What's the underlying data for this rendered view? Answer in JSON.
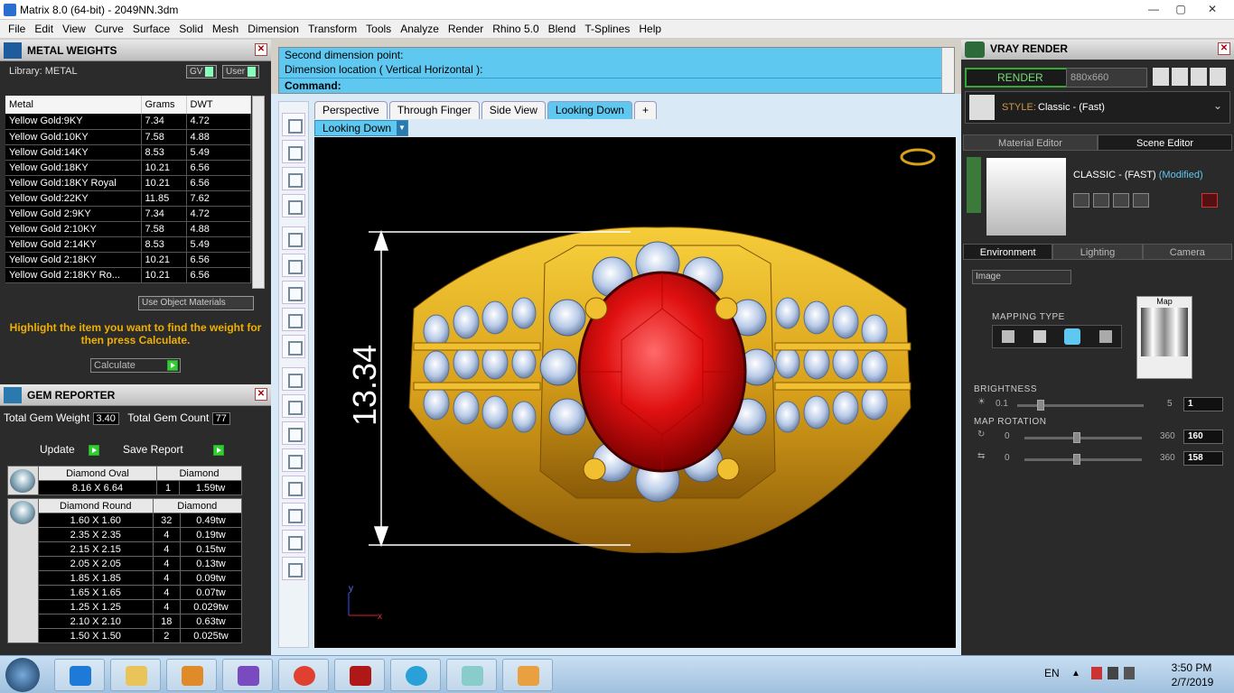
{
  "window": {
    "title": "Matrix 8.0 (64-bit) - 2049NN.3dm",
    "min": "—",
    "max": "▢",
    "close": "✕"
  },
  "menu": [
    "File",
    "Edit",
    "View",
    "Curve",
    "Surface",
    "Solid",
    "Mesh",
    "Dimension",
    "Transform",
    "Tools",
    "Analyze",
    "Render",
    "Rhino 5.0",
    "Blend",
    "T-Splines",
    "Help"
  ],
  "metal_weights": {
    "title": "METAL WEIGHTS",
    "library": "Library: METAL",
    "gv_btn": "GV",
    "user_btn": "User",
    "columns": [
      "Metal",
      "Grams",
      "DWT"
    ],
    "rows": [
      [
        "Yellow Gold:9KY",
        "7.34",
        "4.72"
      ],
      [
        "Yellow Gold:10KY",
        "7.58",
        "4.88"
      ],
      [
        "Yellow Gold:14KY",
        "8.53",
        "5.49"
      ],
      [
        "Yellow Gold:18KY",
        "10.21",
        "6.56"
      ],
      [
        "Yellow Gold:18KY Royal",
        "10.21",
        "6.56"
      ],
      [
        "Yellow Gold:22KY",
        "11.85",
        "7.62"
      ],
      [
        "Yellow Gold 2:9KY",
        "7.34",
        "4.72"
      ],
      [
        "Yellow Gold 2:10KY",
        "7.58",
        "4.88"
      ],
      [
        "Yellow Gold 2:14KY",
        "8.53",
        "5.49"
      ],
      [
        "Yellow Gold 2:18KY",
        "10.21",
        "6.56"
      ],
      [
        "Yellow Gold 2:18KY Ro...",
        "10.21",
        "6.56"
      ]
    ],
    "use_object_materials": "Use Object Materials",
    "hint": "Highlight the item you want to find the weight for then press Calculate.",
    "calculate": "Calculate"
  },
  "gem_reporter": {
    "title": "GEM REPORTER",
    "total_weight_label": "Total Gem Weight",
    "total_weight": "3.40",
    "total_count_label": "Total Gem Count",
    "total_count": "77",
    "update": "Update",
    "save_report": "Save Report",
    "groups": [
      {
        "shape": "Diamond Oval",
        "material": "Diamond",
        "rows": [
          [
            "8.16 X 6.64",
            "1",
            "1.59tw"
          ]
        ]
      },
      {
        "shape": "Diamond Round",
        "material": "Diamond",
        "rows": [
          [
            "1.60 X 1.60",
            "32",
            "0.49tw"
          ],
          [
            "2.35 X 2.35",
            "4",
            "0.19tw"
          ],
          [
            "2.15 X 2.15",
            "4",
            "0.15tw"
          ],
          [
            "2.05 X 2.05",
            "4",
            "0.13tw"
          ],
          [
            "1.85 X 1.85",
            "4",
            "0.09tw"
          ],
          [
            "1.65 X 1.65",
            "4",
            "0.07tw"
          ],
          [
            "1.25 X 1.25",
            "4",
            "0.029tw"
          ],
          [
            "2.10 X 2.10",
            "18",
            "0.63tw"
          ],
          [
            "1.50 X 1.50",
            "2",
            "0.025tw"
          ]
        ]
      }
    ]
  },
  "command": {
    "line1": "Second dimension point:",
    "line2": "Dimension location ( Vertical  Horizontal ):",
    "prompt": "Command:"
  },
  "viewport": {
    "tabs": [
      "Perspective",
      "Through Finger",
      "Side View",
      "Looking Down"
    ],
    "active_tab": "Looking Down",
    "add_tab": "+",
    "selector": "Looking Down",
    "dimension": "13.34",
    "axis_y": "y",
    "axis_x": "x"
  },
  "vray": {
    "title": "VRAY RENDER",
    "render_btn": "RENDER",
    "resolution": "880x660",
    "style_label": "STYLE:",
    "style_value": "Classic - (Fast)",
    "tabs": [
      "Material Editor",
      "Scene Editor"
    ],
    "scene_name": "CLASSIC - (FAST)",
    "modified": "(Modified)",
    "env_tabs": [
      "Environment",
      "Lighting",
      "Camera"
    ],
    "env_select": "Image",
    "map_label": "Map",
    "mapping_type": "MAPPING TYPE",
    "brightness_label": "BRIGHTNESS",
    "brightness": {
      "min": "0.1",
      "max": "5",
      "value": "1"
    },
    "map_rotation_label": "MAP ROTATION",
    "rotation1": {
      "min": "0",
      "max": "360",
      "value": "160"
    },
    "rotation2": {
      "min": "0",
      "max": "360",
      "value": "158"
    }
  },
  "taskbar": {
    "lang": "EN",
    "time": "3:50 PM",
    "date": "2/7/2019"
  },
  "colors": {
    "accent": "#5ec8f0",
    "gold": "#d9a11a",
    "ruby": "#d41010",
    "hint": "#f0b000"
  }
}
